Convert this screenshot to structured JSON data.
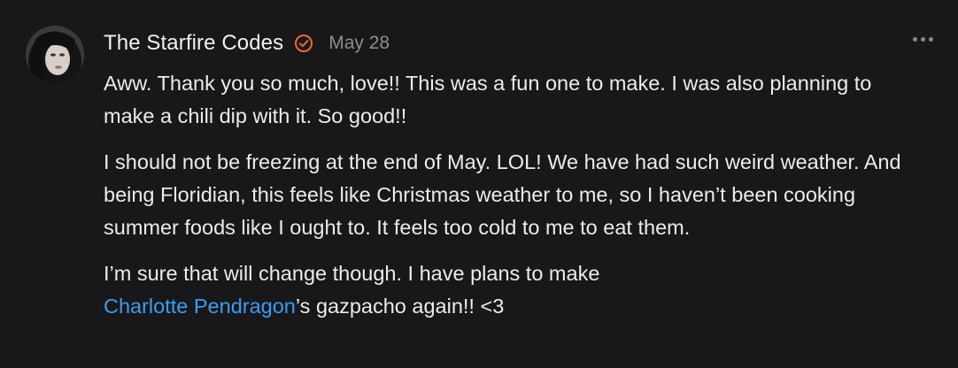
{
  "comment": {
    "author": "The Starfire Codes",
    "date": "May 28",
    "paragraphs": [
      "Aww. Thank you so much, love!! This was a fun one to make. I was also planning to make a chili dip with it. So good!!",
      "I should not be freezing at the end of May. LOL! We have had such weird weather. And being Floridian, this feels like Christmas weather to me, so I haven’t been cooking summer foods like I ought to. It feels too cold to me to eat them."
    ],
    "last_paragraph": {
      "before": "I’m sure that will change though. I have plans to make",
      "mention": "Charlotte Pendragon",
      "after": "’s gazpacho again!! <3"
    },
    "icons": {
      "verified": "verified-badge-icon",
      "more": "more-options-icon"
    },
    "colors": {
      "background": "#18181a",
      "text": "#ececec",
      "muted": "#8e8e92",
      "verified": "#f06a28",
      "mention": "#3b9cf0"
    }
  }
}
